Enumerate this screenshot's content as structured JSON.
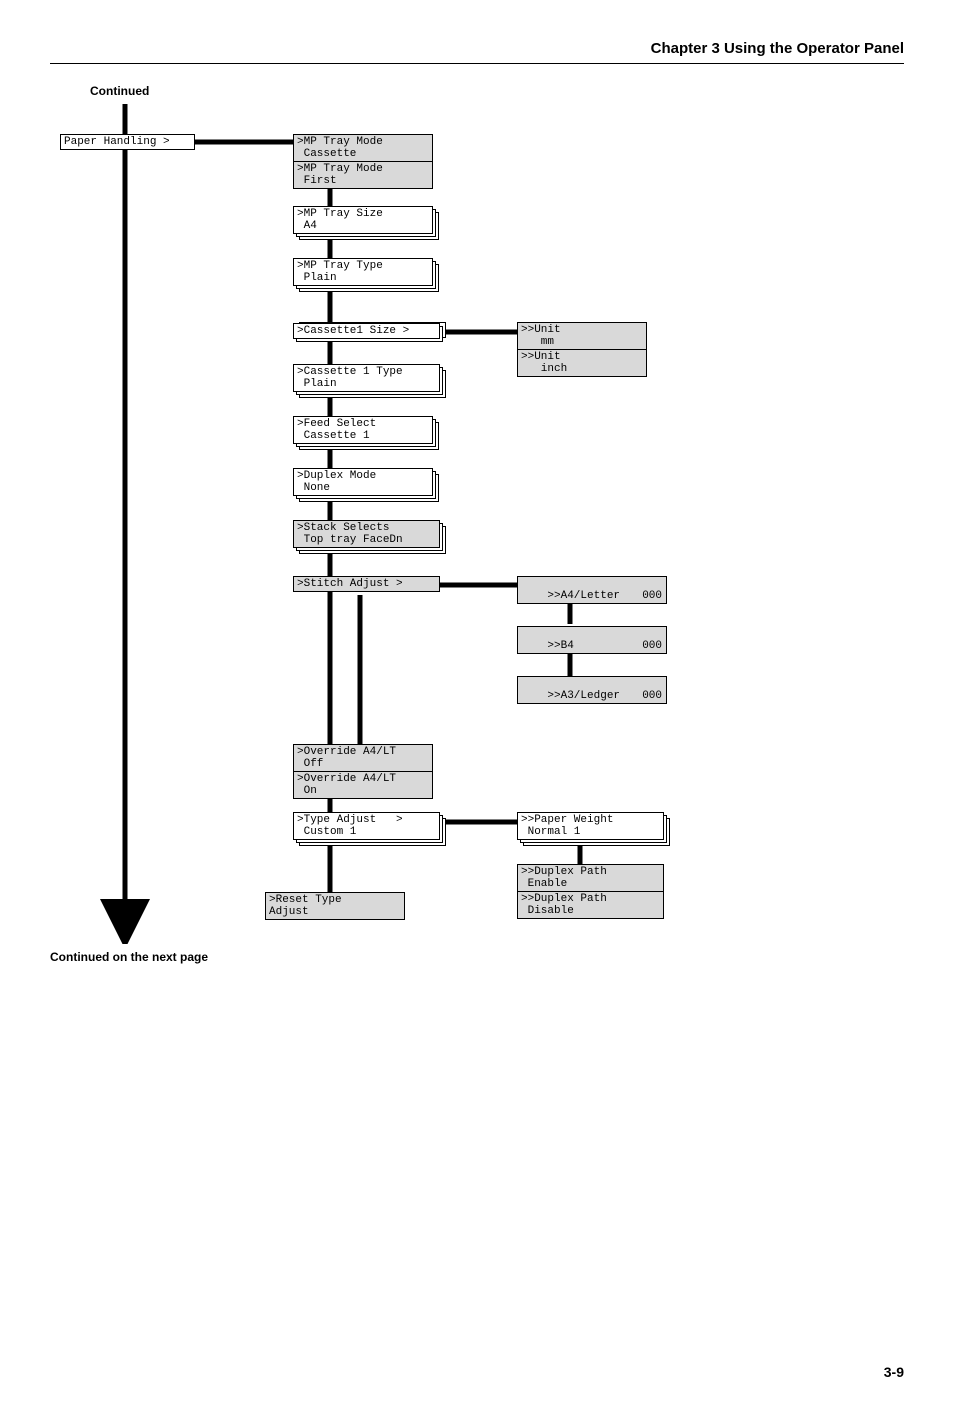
{
  "header": "Chapter 3  Using the Operator Panel",
  "continued_top": "Continued",
  "continued_bottom": "Continued on the next page",
  "page_num": "3-9",
  "col1": {
    "paper_handling": "Paper Handling >"
  },
  "col2": {
    "mp_mode_cassette": ">MP Tray Mode\n Cassette",
    "mp_mode_first": ">MP Tray Mode\n First",
    "mp_size": ">MP Tray Size\n A4",
    "mp_type": ">MP Tray Type\n Plain",
    "cassette1_size": ">Cassette1 Size >",
    "cassette1_type": ">Cassette 1 Type\n Plain",
    "feed_select": ">Feed Select\n Cassette 1",
    "duplex_mode": ">Duplex Mode\n None",
    "stack_selects": ">Stack Selects\n Top tray FaceDn",
    "stitch_adjust": ">Stitch Adjust >",
    "override_off": ">Override A4/LT\n Off",
    "override_on": ">Override A4/LT\n On",
    "type_adjust": ">Type Adjust   >\n Custom 1",
    "reset_type": ">Reset Type\nAdjust"
  },
  "col3": {
    "unit_mm": ">>Unit\n   mm",
    "unit_inch": ">>Unit\n   inch",
    "a4_letter_l1": ">>A4/Letter",
    "a4_letter_l2": "000",
    "b4_l1": ">>B4",
    "b4_l2": "000",
    "a3_ledger_l1": ">>A3/Ledger",
    "a3_ledger_l2": "000",
    "paper_weight": ">>Paper Weight\n Normal 1",
    "duplex_enable": ">>Duplex Path\n Enable",
    "duplex_disable": ">>Duplex Path\n Disable"
  }
}
